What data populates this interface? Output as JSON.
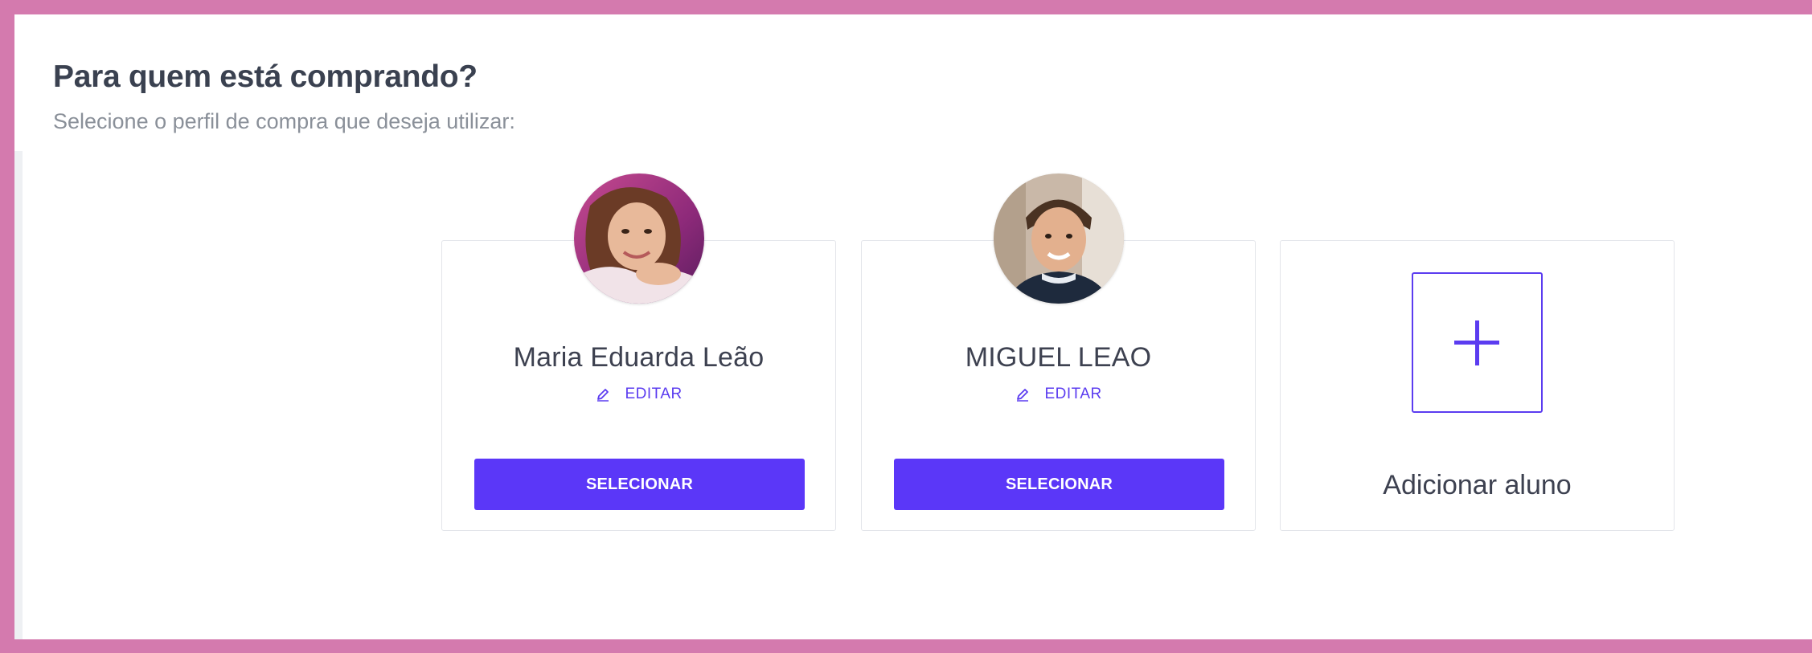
{
  "header": {
    "title": "Para quem está comprando?",
    "subtitle": "Selecione o perfil de compra que deseja utilizar:"
  },
  "profiles": [
    {
      "name": "Maria Eduarda Leão",
      "edit_label": "EDITAR",
      "edit_icon": "pencil-icon",
      "select_label": "SELECIONAR",
      "avatar": "photo-girl"
    },
    {
      "name": "MIGUEL LEAO",
      "edit_label": "EDITAR",
      "edit_icon": "pencil-icon",
      "select_label": "SELECIONAR",
      "avatar": "photo-boy"
    }
  ],
  "add_student": {
    "label": "Adicionar aluno",
    "icon": "plus-icon"
  },
  "colors": {
    "frame": "#d47aae",
    "accent": "#5b37f8",
    "title_text": "#3a4150",
    "subtitle_text": "#8a9099"
  }
}
